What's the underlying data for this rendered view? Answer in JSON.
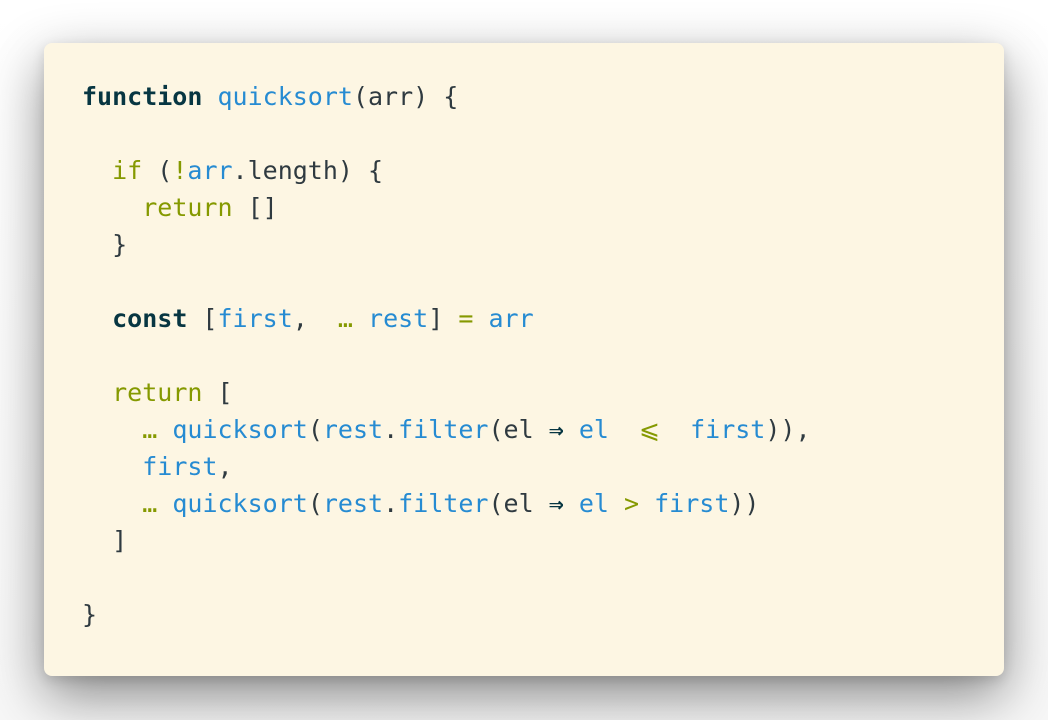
{
  "code": {
    "lines": [
      [
        {
          "t": "function",
          "k": "keyword"
        },
        {
          "t": " ",
          "k": "text"
        },
        {
          "t": "quicksort",
          "k": "fn"
        },
        {
          "t": "(arr) {",
          "k": "punc"
        }
      ],
      [],
      [
        {
          "t": "  ",
          "k": "text"
        },
        {
          "t": "if",
          "k": "control"
        },
        {
          "t": " (",
          "k": "punc"
        },
        {
          "t": "!",
          "k": "op"
        },
        {
          "t": "arr",
          "k": "var"
        },
        {
          "t": ".length) {",
          "k": "punc"
        }
      ],
      [
        {
          "t": "    ",
          "k": "text"
        },
        {
          "t": "return",
          "k": "control"
        },
        {
          "t": " []",
          "k": "punc"
        }
      ],
      [
        {
          "t": "  }",
          "k": "punc"
        }
      ],
      [],
      [
        {
          "t": "  ",
          "k": "text"
        },
        {
          "t": "const",
          "k": "keyword"
        },
        {
          "t": " [",
          "k": "punc"
        },
        {
          "t": "first",
          "k": "var"
        },
        {
          "t": ",  ",
          "k": "punc"
        },
        {
          "t": "…",
          "k": "op"
        },
        {
          "t": " ",
          "k": "text"
        },
        {
          "t": "rest",
          "k": "var"
        },
        {
          "t": "] ",
          "k": "punc"
        },
        {
          "t": "=",
          "k": "op"
        },
        {
          "t": " ",
          "k": "text"
        },
        {
          "t": "arr",
          "k": "var"
        }
      ],
      [],
      [
        {
          "t": "  ",
          "k": "text"
        },
        {
          "t": "return",
          "k": "control"
        },
        {
          "t": " [",
          "k": "punc"
        }
      ],
      [
        {
          "t": "    ",
          "k": "text"
        },
        {
          "t": "…",
          "k": "op"
        },
        {
          "t": " ",
          "k": "text"
        },
        {
          "t": "quicksort",
          "k": "fn"
        },
        {
          "t": "(",
          "k": "punc"
        },
        {
          "t": "rest",
          "k": "var"
        },
        {
          "t": ".",
          "k": "punc"
        },
        {
          "t": "filter",
          "k": "fn"
        },
        {
          "t": "(el ",
          "k": "punc"
        },
        {
          "t": "⇒",
          "k": "keyword"
        },
        {
          "t": " ",
          "k": "text"
        },
        {
          "t": "el",
          "k": "var"
        },
        {
          "t": "  ",
          "k": "text"
        },
        {
          "t": "⩽",
          "k": "op"
        },
        {
          "t": "  ",
          "k": "text"
        },
        {
          "t": "first",
          "k": "var"
        },
        {
          "t": ")),",
          "k": "punc"
        }
      ],
      [
        {
          "t": "    ",
          "k": "text"
        },
        {
          "t": "first",
          "k": "var"
        },
        {
          "t": ",",
          "k": "punc"
        }
      ],
      [
        {
          "t": "    ",
          "k": "text"
        },
        {
          "t": "…",
          "k": "op"
        },
        {
          "t": " ",
          "k": "text"
        },
        {
          "t": "quicksort",
          "k": "fn"
        },
        {
          "t": "(",
          "k": "punc"
        },
        {
          "t": "rest",
          "k": "var"
        },
        {
          "t": ".",
          "k": "punc"
        },
        {
          "t": "filter",
          "k": "fn"
        },
        {
          "t": "(el ",
          "k": "punc"
        },
        {
          "t": "⇒",
          "k": "keyword"
        },
        {
          "t": " ",
          "k": "text"
        },
        {
          "t": "el",
          "k": "var"
        },
        {
          "t": " ",
          "k": "text"
        },
        {
          "t": ">",
          "k": "op"
        },
        {
          "t": " ",
          "k": "text"
        },
        {
          "t": "first",
          "k": "var"
        },
        {
          "t": "))",
          "k": "punc"
        }
      ],
      [
        {
          "t": "  ]",
          "k": "punc"
        }
      ],
      [],
      [
        {
          "t": "}",
          "k": "punc"
        }
      ]
    ]
  },
  "colors": {
    "background": "#fdf6e3",
    "keyword": "#073642",
    "control": "#859900",
    "identifier": "#268bd2",
    "text": "#2f3a40"
  }
}
